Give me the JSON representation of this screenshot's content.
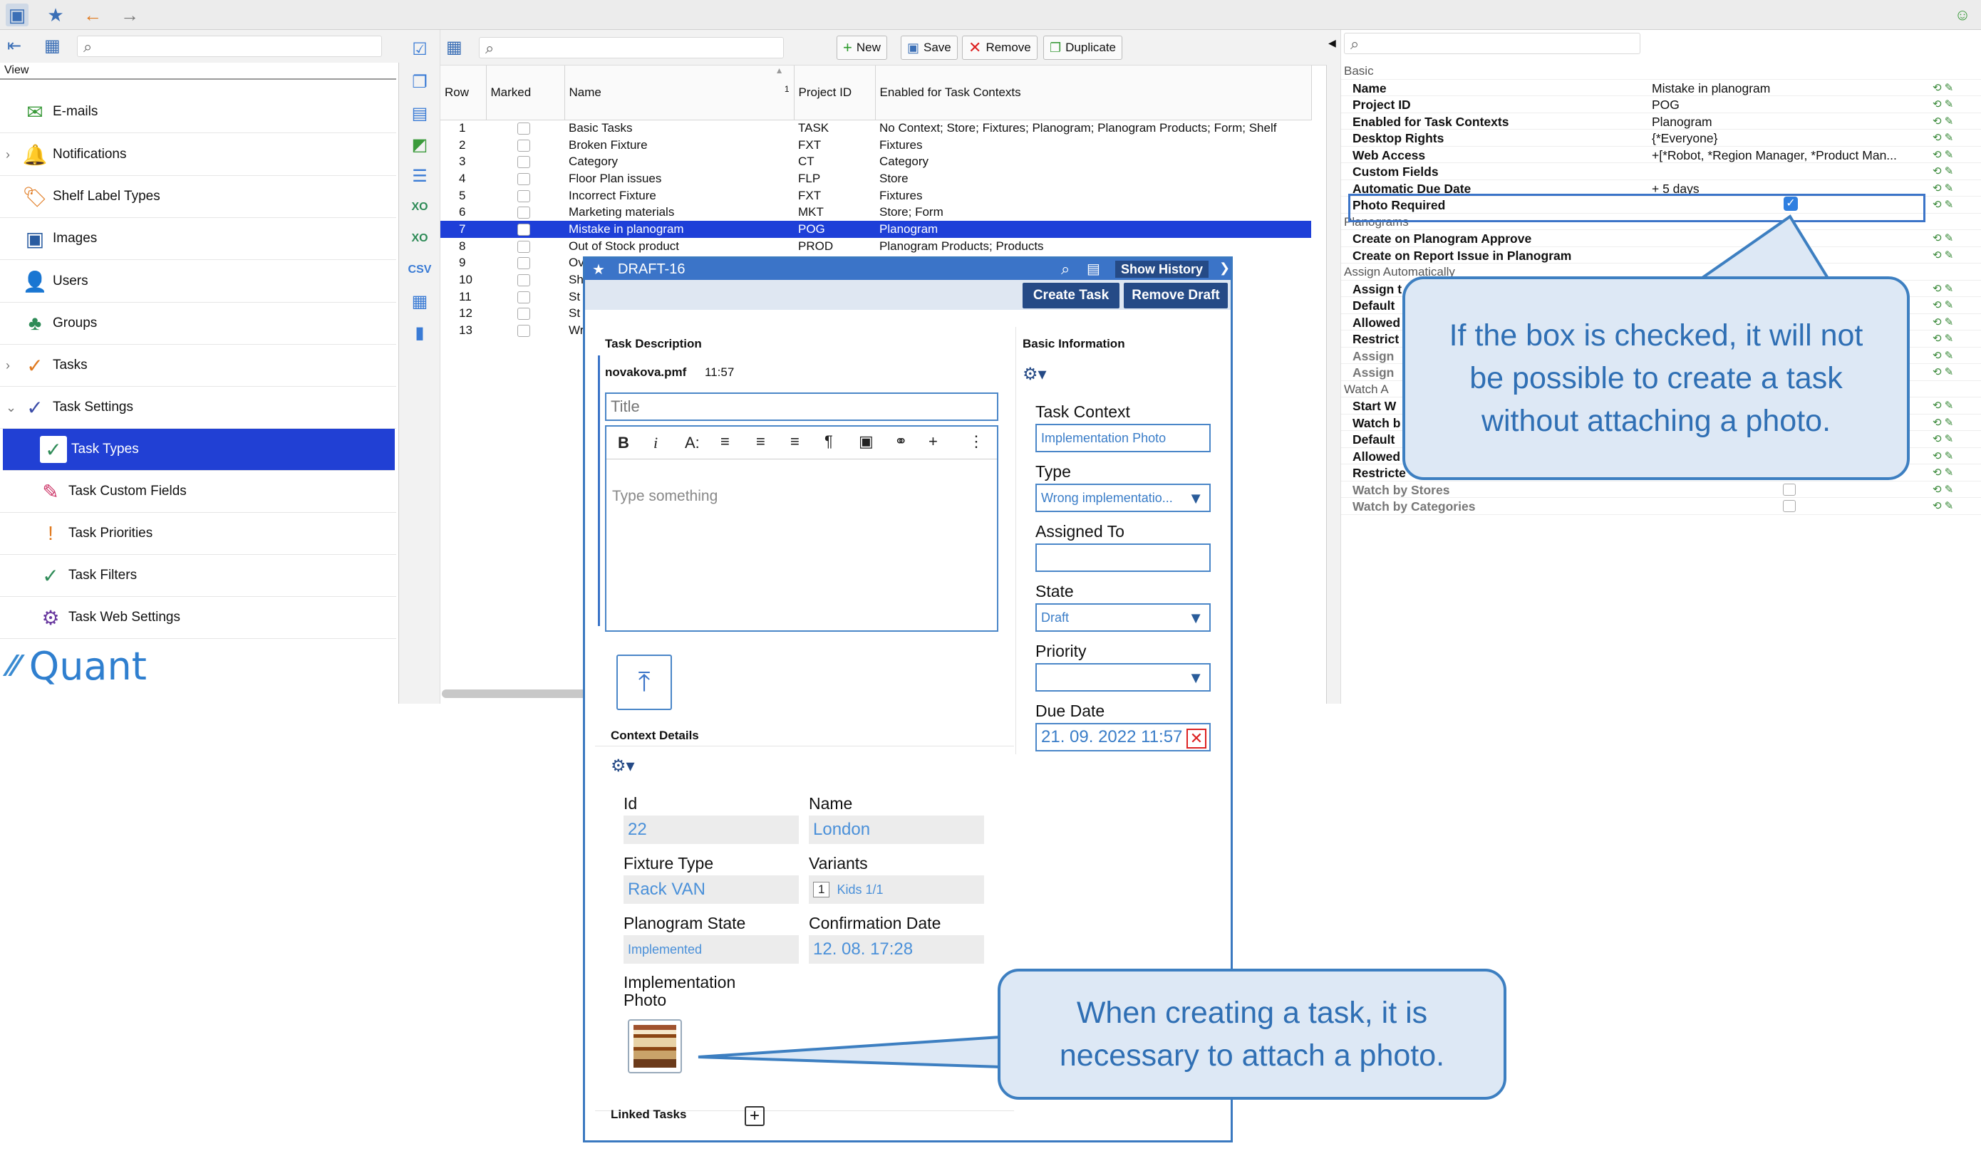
{
  "left_panel": {
    "view_label": "View",
    "items": [
      {
        "label": "E-mails",
        "icon": "envelope-icon"
      },
      {
        "label": "Notifications",
        "icon": "bell-icon"
      },
      {
        "label": "Shelf Label Types",
        "icon": "tag-icon"
      },
      {
        "label": "Images",
        "icon": "image-icon"
      },
      {
        "label": "Users",
        "icon": "user-icon"
      },
      {
        "label": "Groups",
        "icon": "group-icon"
      },
      {
        "label": "Tasks",
        "icon": "check-circle-icon"
      },
      {
        "label": "Task Settings",
        "icon": "task-settings-icon"
      },
      {
        "label": "Task Types",
        "icon": "task-types-icon"
      },
      {
        "label": "Task Custom Fields",
        "icon": "custom-fields-icon"
      },
      {
        "label": "Task Priorities",
        "icon": "priorities-icon"
      },
      {
        "label": "Task Filters",
        "icon": "filters-icon"
      },
      {
        "label": "Task Web Settings",
        "icon": "web-settings-icon"
      }
    ],
    "logo_text": "Quant"
  },
  "toolbar": {
    "new_label": "New",
    "save_label": "Save",
    "remove_label": "Remove",
    "duplicate_label": "Duplicate"
  },
  "table": {
    "headers": [
      "Row",
      "Marked",
      "Name",
      "Project ID",
      "Enabled for Task Contexts"
    ],
    "sort_indicator": "1",
    "rows": [
      [
        "1",
        "",
        "Basic Tasks",
        "TASK",
        "No Context; Store; Fixtures; Planogram; Planogram Products; Form; Shelf"
      ],
      [
        "2",
        "",
        "Broken Fixture",
        "FXT",
        "Fixtures"
      ],
      [
        "3",
        "",
        "Category",
        "CT",
        "Category"
      ],
      [
        "4",
        "",
        "Floor Plan issues",
        "FLP",
        "Store"
      ],
      [
        "5",
        "",
        "Incorrect Fixture",
        "FXT",
        "Fixtures"
      ],
      [
        "6",
        "",
        "Marketing materials",
        "MKT",
        "Store; Form"
      ],
      [
        "7",
        "",
        "Mistake in planogram",
        "POG",
        "Planogram"
      ],
      [
        "8",
        "",
        "Out of Stock product",
        "PROD",
        "Planogram Products; Products"
      ],
      [
        "9",
        "",
        "Ov",
        "",
        ""
      ],
      [
        "10",
        "",
        "Sh",
        "",
        ""
      ],
      [
        "11",
        "",
        "St",
        "",
        ""
      ],
      [
        "12",
        "",
        "St",
        "",
        ""
      ],
      [
        "13",
        "",
        "Wr",
        "",
        ""
      ]
    ],
    "selected_row": 7
  },
  "properties": {
    "section_basic": "Basic",
    "rows": [
      {
        "key": "Name",
        "value": "Mistake in planogram"
      },
      {
        "key": "Project ID",
        "value": "POG"
      },
      {
        "key": "Enabled for Task Contexts",
        "value": "Planogram"
      },
      {
        "key": "Desktop Rights",
        "value": "{*Everyone}"
      },
      {
        "key": "Web Access",
        "value": "+[*Robot, *Region Manager, *Product Man..."
      },
      {
        "key": "Custom Fields",
        "value": ""
      },
      {
        "key": "Automatic Due Date",
        "value": "+ 5 days"
      },
      {
        "key": "Photo Required",
        "value": ""
      }
    ],
    "section_planograms": "Planograms",
    "planogram_rows": [
      {
        "key": "Create on Planogram Approve",
        "value": ""
      },
      {
        "key": "Create on Report Issue in Planogram",
        "value": ""
      }
    ],
    "section_assign": "Assign Automatically",
    "assign_rows": [
      "Assign t",
      "Default",
      "Allowed",
      "Restrict",
      "Assign",
      "Assign"
    ],
    "section_watch": "Watch A",
    "watch_rows": [
      "Start W",
      "Watch b",
      "Default",
      "Allowed",
      "Restricte",
      "Watch by Stores",
      "Watch by Categories"
    ]
  },
  "draft": {
    "title": "DRAFT-16",
    "show_history": "Show History",
    "create_task": "Create Task",
    "remove_draft": "Remove Draft",
    "task_description_label": "Task Description",
    "author": "novakova.pmf",
    "time": "11:57",
    "title_placeholder": "Title",
    "body_placeholder": "Type something",
    "basic_information_label": "Basic Information",
    "task_context_label": "Task Context",
    "task_context_value": "Implementation Photo",
    "type_label": "Type",
    "type_value": "Wrong implementatio...",
    "assigned_to_label": "Assigned To",
    "assigned_to_value": "",
    "state_label": "State",
    "state_value": "Draft",
    "priority_label": "Priority",
    "priority_value": "",
    "due_date_label": "Due Date",
    "due_date_value": "21. 09. 2022 11:57",
    "context_details_label": "Context Details",
    "id_label": "Id",
    "id_value": "22",
    "name_label": "Name",
    "name_value": "London",
    "fixture_type_label": "Fixture Type",
    "fixture_type_value": "Rack VAN",
    "variants_label": "Variants",
    "variants_count": "1",
    "variants_value": "Kids 1/1",
    "planogram_state_label": "Planogram State",
    "planogram_state_value": "Implemented",
    "confirmation_date_label": "Confirmation Date",
    "confirmation_date_value": "12. 08. 17:28",
    "implementation_photo_label": "Implementation Photo",
    "linked_tasks_label": "Linked Tasks"
  },
  "callouts": {
    "top": "If the box is checked, it will not be possible to create a task without attaching a photo.",
    "bottom": "When creating a task, it is necessary to attach a photo."
  },
  "colors": {
    "selection": "#1e3fd8",
    "accent": "#3b74c8",
    "callout_bg": "#dde8f5",
    "callout_border": "#3d7fc1",
    "dark_button": "#254a86"
  }
}
